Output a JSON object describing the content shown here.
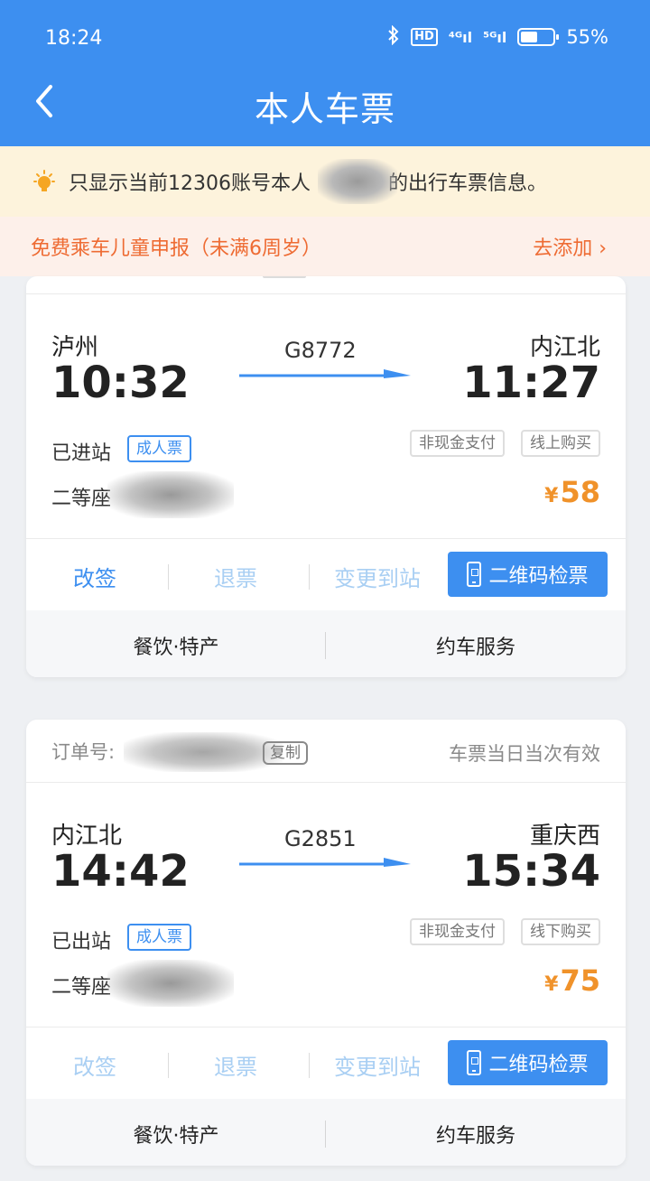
{
  "status_bar": {
    "time": "18:24",
    "icons": [
      "bluetooth-icon",
      "hd-icon",
      "4g-signal-icon",
      "5g-signal-icon",
      "battery-icon"
    ],
    "hd": "HD",
    "net1": "⁴ᴳıl",
    "net2": "⁵ᴳıl",
    "battery": "55%"
  },
  "header": {
    "title": "本人车票"
  },
  "notice": {
    "text": "只显示当前12306账号本人",
    "text_after": "的出行车票信息。"
  },
  "child_notice": {
    "text": "免费乘车儿童申报（未满6周岁）",
    "action": "去添加 ›"
  },
  "tickets": [
    {
      "from_station": "泸州",
      "to_station": "内江北",
      "depart_time": "10:32",
      "arrive_time": "11:27",
      "train_no": "G8772",
      "status": "已进站",
      "ticket_type": "成人票",
      "tags": [
        "非现金支付",
        "线上购买"
      ],
      "seat": "二等座",
      "price": "58",
      "currency": "¥",
      "actions": {
        "change": "改签",
        "refund": "退票",
        "change_station": "变更到站",
        "qr": "二维码检票"
      },
      "services": [
        "餐饮·特产",
        "约车服务"
      ]
    },
    {
      "order_label": "订单号:",
      "copy": "复制",
      "validity": "车票当日当次有效",
      "from_station": "内江北",
      "to_station": "重庆西",
      "depart_time": "14:42",
      "arrive_time": "15:34",
      "train_no": "G2851",
      "status": "已出站",
      "ticket_type": "成人票",
      "tags": [
        "非现金支付",
        "线下购买"
      ],
      "seat": "二等座",
      "price": "75",
      "currency": "¥",
      "actions": {
        "change": "改签",
        "refund": "退票",
        "change_station": "变更到站",
        "qr": "二维码检票"
      },
      "services": [
        "餐饮·特产",
        "约车服务"
      ]
    }
  ],
  "colors": {
    "primary": "#3d8ff0",
    "price": "#f0922a",
    "notice_bg": "#fdf3dc",
    "child_notice_text": "#ee6b33"
  }
}
